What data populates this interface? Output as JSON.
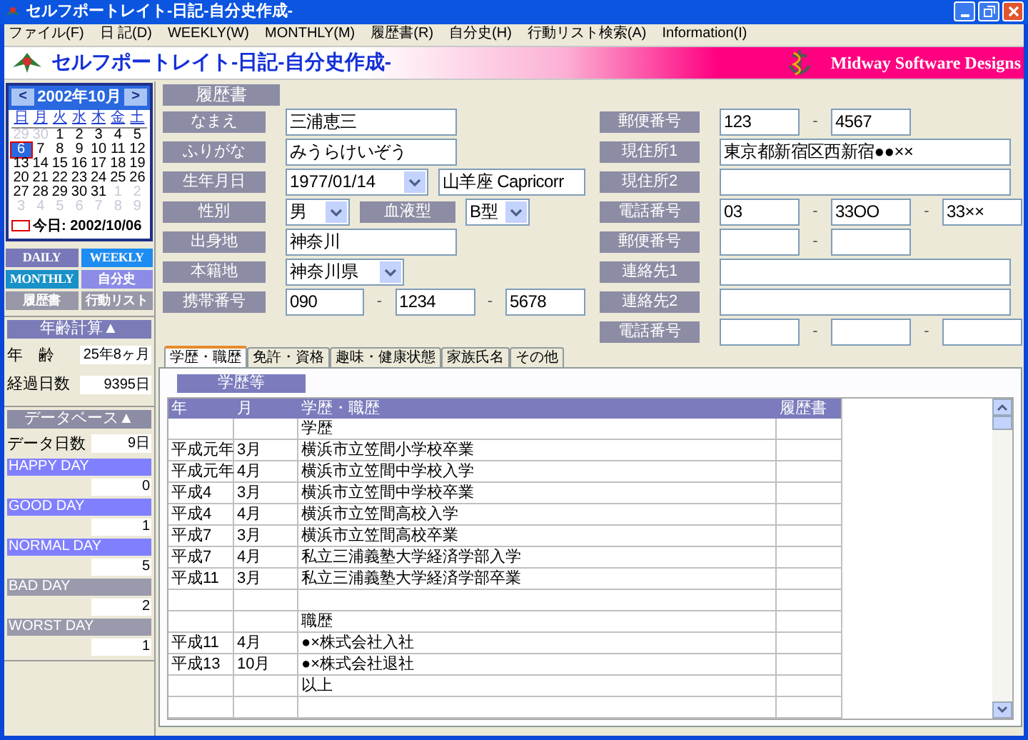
{
  "window": {
    "title": "セルフポートレイト-日記-自分史作成-"
  },
  "menu": [
    "ファイル(F)",
    "日 記(D)",
    "WEEKLY(W)",
    "MONTHLY(M)",
    "履歴書(R)",
    "自分史(H)",
    "行動リスト検索(A)",
    "Information(I)"
  ],
  "banner": {
    "title": "セルフポートレイト-日記-自分史作成-",
    "company": "Midway Software Designs"
  },
  "calendar": {
    "month": "2002年10月",
    "prev": "<",
    "next": ">",
    "weekdays": [
      "日",
      "月",
      "火",
      "水",
      "木",
      "金",
      "土"
    ],
    "days": [
      {
        "d": "29",
        "muted": true,
        "selected": false
      },
      {
        "d": "30",
        "muted": true,
        "selected": false
      },
      {
        "d": "1",
        "muted": false,
        "selected": false
      },
      {
        "d": "2",
        "muted": false,
        "selected": false
      },
      {
        "d": "3",
        "muted": false,
        "selected": false
      },
      {
        "d": "4",
        "muted": false,
        "selected": false
      },
      {
        "d": "5",
        "muted": false,
        "selected": false
      },
      {
        "d": "6",
        "muted": false,
        "selected": true
      },
      {
        "d": "7",
        "muted": false,
        "selected": false
      },
      {
        "d": "8",
        "muted": false,
        "selected": false
      },
      {
        "d": "9",
        "muted": false,
        "selected": false
      },
      {
        "d": "10",
        "muted": false,
        "selected": false
      },
      {
        "d": "11",
        "muted": false,
        "selected": false
      },
      {
        "d": "12",
        "muted": false,
        "selected": false
      },
      {
        "d": "13",
        "muted": false,
        "selected": false
      },
      {
        "d": "14",
        "muted": false,
        "selected": false
      },
      {
        "d": "15",
        "muted": false,
        "selected": false
      },
      {
        "d": "16",
        "muted": false,
        "selected": false
      },
      {
        "d": "17",
        "muted": false,
        "selected": false
      },
      {
        "d": "18",
        "muted": false,
        "selected": false
      },
      {
        "d": "19",
        "muted": false,
        "selected": false
      },
      {
        "d": "20",
        "muted": false,
        "selected": false
      },
      {
        "d": "21",
        "muted": false,
        "selected": false
      },
      {
        "d": "22",
        "muted": false,
        "selected": false
      },
      {
        "d": "23",
        "muted": false,
        "selected": false
      },
      {
        "d": "24",
        "muted": false,
        "selected": false
      },
      {
        "d": "25",
        "muted": false,
        "selected": false
      },
      {
        "d": "26",
        "muted": false,
        "selected": false
      },
      {
        "d": "27",
        "muted": false,
        "selected": false
      },
      {
        "d": "28",
        "muted": false,
        "selected": false
      },
      {
        "d": "29",
        "muted": false,
        "selected": false
      },
      {
        "d": "30",
        "muted": false,
        "selected": false
      },
      {
        "d": "31",
        "muted": false,
        "selected": false
      },
      {
        "d": "1",
        "muted": true,
        "selected": false
      },
      {
        "d": "2",
        "muted": true,
        "selected": false
      },
      {
        "d": "3",
        "muted": true,
        "selected": false
      },
      {
        "d": "4",
        "muted": true,
        "selected": false
      },
      {
        "d": "5",
        "muted": true,
        "selected": false
      },
      {
        "d": "6",
        "muted": true,
        "selected": false
      },
      {
        "d": "7",
        "muted": true,
        "selected": false
      },
      {
        "d": "8",
        "muted": true,
        "selected": false
      },
      {
        "d": "9",
        "muted": true,
        "selected": false
      }
    ],
    "today": "今日: 2002/10/06"
  },
  "nav_buttons": [
    {
      "label": "DAILY",
      "color": "#7878b8"
    },
    {
      "label": "WEEKLY",
      "color": "#1e8cf0"
    },
    {
      "label": "MONTHLY",
      "color": "#1890c8"
    },
    {
      "label": "自分史",
      "color": "#8c8ce8"
    },
    {
      "label": "履歴書",
      "color": "#9898a8"
    },
    {
      "label": "行動リスト",
      "color": "#9898a8"
    }
  ],
  "age_calc": {
    "title": "年齢計算▲",
    "rows": [
      {
        "label": "年　齢",
        "value": "25年8ヶ月"
      },
      {
        "label": "経過日数",
        "value": "9395日"
      }
    ]
  },
  "database": {
    "title": "データベース▲",
    "days_label": "データ日数",
    "days_value": "9日",
    "categories": [
      {
        "label": "HAPPY DAY",
        "value": "0",
        "color": "#8080ff"
      },
      {
        "label": "GOOD DAY",
        "value": "1",
        "color": "#8080ff"
      },
      {
        "label": "NORMAL DAY",
        "value": "5",
        "color": "#8080ff"
      },
      {
        "label": "BAD DAY",
        "value": "2",
        "color": "#9a9aac"
      },
      {
        "label": "WORST DAY",
        "value": "1",
        "color": "#9a9aac"
      }
    ]
  },
  "form": {
    "title": "履歴書",
    "left": [
      {
        "label": "なまえ",
        "parts": [
          {
            "kind": "field",
            "value": "三浦恵三"
          }
        ]
      },
      {
        "label": "ふりがな",
        "parts": [
          {
            "kind": "field",
            "value": "みうらけいぞう"
          }
        ]
      },
      {
        "label": "生年月日",
        "parts": [
          {
            "kind": "select",
            "value": "1977/01/14"
          },
          {
            "kind": "field",
            "value": "山羊座 Capricorr"
          }
        ]
      },
      {
        "label": "性別",
        "parts": [
          {
            "kind": "select",
            "value": "男"
          },
          {
            "kind": "label",
            "value": "血液型"
          },
          {
            "kind": "select",
            "value": "B型"
          }
        ]
      },
      {
        "label": "出身地",
        "parts": [
          {
            "kind": "field",
            "value": "神奈川"
          }
        ]
      },
      {
        "label": "本籍地",
        "parts": [
          {
            "kind": "select",
            "value": "神奈川県"
          }
        ]
      },
      {
        "label": "携帯番号",
        "parts": [
          {
            "kind": "field",
            "value": "090"
          },
          {
            "kind": "dash",
            "value": "-"
          },
          {
            "kind": "field",
            "value": "1234"
          },
          {
            "kind": "dash",
            "value": "-"
          },
          {
            "kind": "field",
            "value": "5678"
          }
        ]
      }
    ],
    "right": [
      {
        "label": "郵便番号",
        "parts": [
          {
            "kind": "field",
            "value": "123"
          },
          {
            "kind": "dash",
            "value": "-"
          },
          {
            "kind": "field",
            "value": "4567"
          }
        ]
      },
      {
        "label": "現住所1",
        "parts": [
          {
            "kind": "field",
            "value": "東京都新宿区西新宿●●××"
          }
        ]
      },
      {
        "label": "現住所2",
        "parts": [
          {
            "kind": "field"
          }
        ]
      },
      {
        "label": "電話番号",
        "parts": [
          {
            "kind": "field",
            "value": "03"
          },
          {
            "kind": "dash",
            "value": "-"
          },
          {
            "kind": "field",
            "value": "33OO"
          },
          {
            "kind": "dash",
            "value": "-"
          },
          {
            "kind": "field",
            "value": "33××"
          }
        ]
      },
      {
        "label": "郵便番号",
        "parts": [
          {
            "kind": "field"
          },
          {
            "kind": "dash",
            "value": "-"
          },
          {
            "kind": "field"
          }
        ]
      },
      {
        "label": "連絡先1",
        "parts": [
          {
            "kind": "field"
          }
        ]
      },
      {
        "label": "連絡先2",
        "parts": [
          {
            "kind": "field"
          }
        ]
      },
      {
        "label": "電話番号",
        "parts": [
          {
            "kind": "field"
          },
          {
            "kind": "dash",
            "value": "-"
          },
          {
            "kind": "field"
          },
          {
            "kind": "dash",
            "value": "-"
          },
          {
            "kind": "field"
          }
        ]
      }
    ]
  },
  "tabs": [
    {
      "label": "学歴・職歴",
      "selected": true
    },
    {
      "label": "免許・資格",
      "selected": false
    },
    {
      "label": "趣味・健康状態",
      "selected": false
    },
    {
      "label": "家族氏名",
      "selected": false
    },
    {
      "label": "その他",
      "selected": false
    }
  ],
  "table": {
    "section": "学歴等",
    "columns": [
      "年",
      "月",
      "学歴・職歴",
      "履歴書"
    ],
    "rows": [
      {
        "entry": "学歴"
      },
      {
        "year": "平成元年",
        "month": "3月",
        "entry": "横浜市立笠間小学校卒業"
      },
      {
        "year": "平成元年",
        "month": "4月",
        "entry": "横浜市立笠間中学校入学"
      },
      {
        "year": "平成4",
        "month": "3月",
        "entry": "横浜市立笠間中学校卒業"
      },
      {
        "year": "平成4",
        "month": "4月",
        "entry": "横浜市立笠間高校入学"
      },
      {
        "year": "平成7",
        "month": "3月",
        "entry": "横浜市立笠間高校卒業"
      },
      {
        "year": "平成7",
        "month": "4月",
        "entry": "私立三浦義塾大学経済学部入学"
      },
      {
        "year": "平成11",
        "month": "3月",
        "entry": "私立三浦義塾大学経済学部卒業"
      },
      {},
      {
        "entry": "職歴"
      },
      {
        "year": "平成11",
        "month": "4月",
        "entry": "●×株式会社入社"
      },
      {
        "year": "平成13",
        "month": "10月",
        "entry": "●×株式会社退社"
      },
      {
        "entry": "以上"
      },
      {}
    ]
  }
}
